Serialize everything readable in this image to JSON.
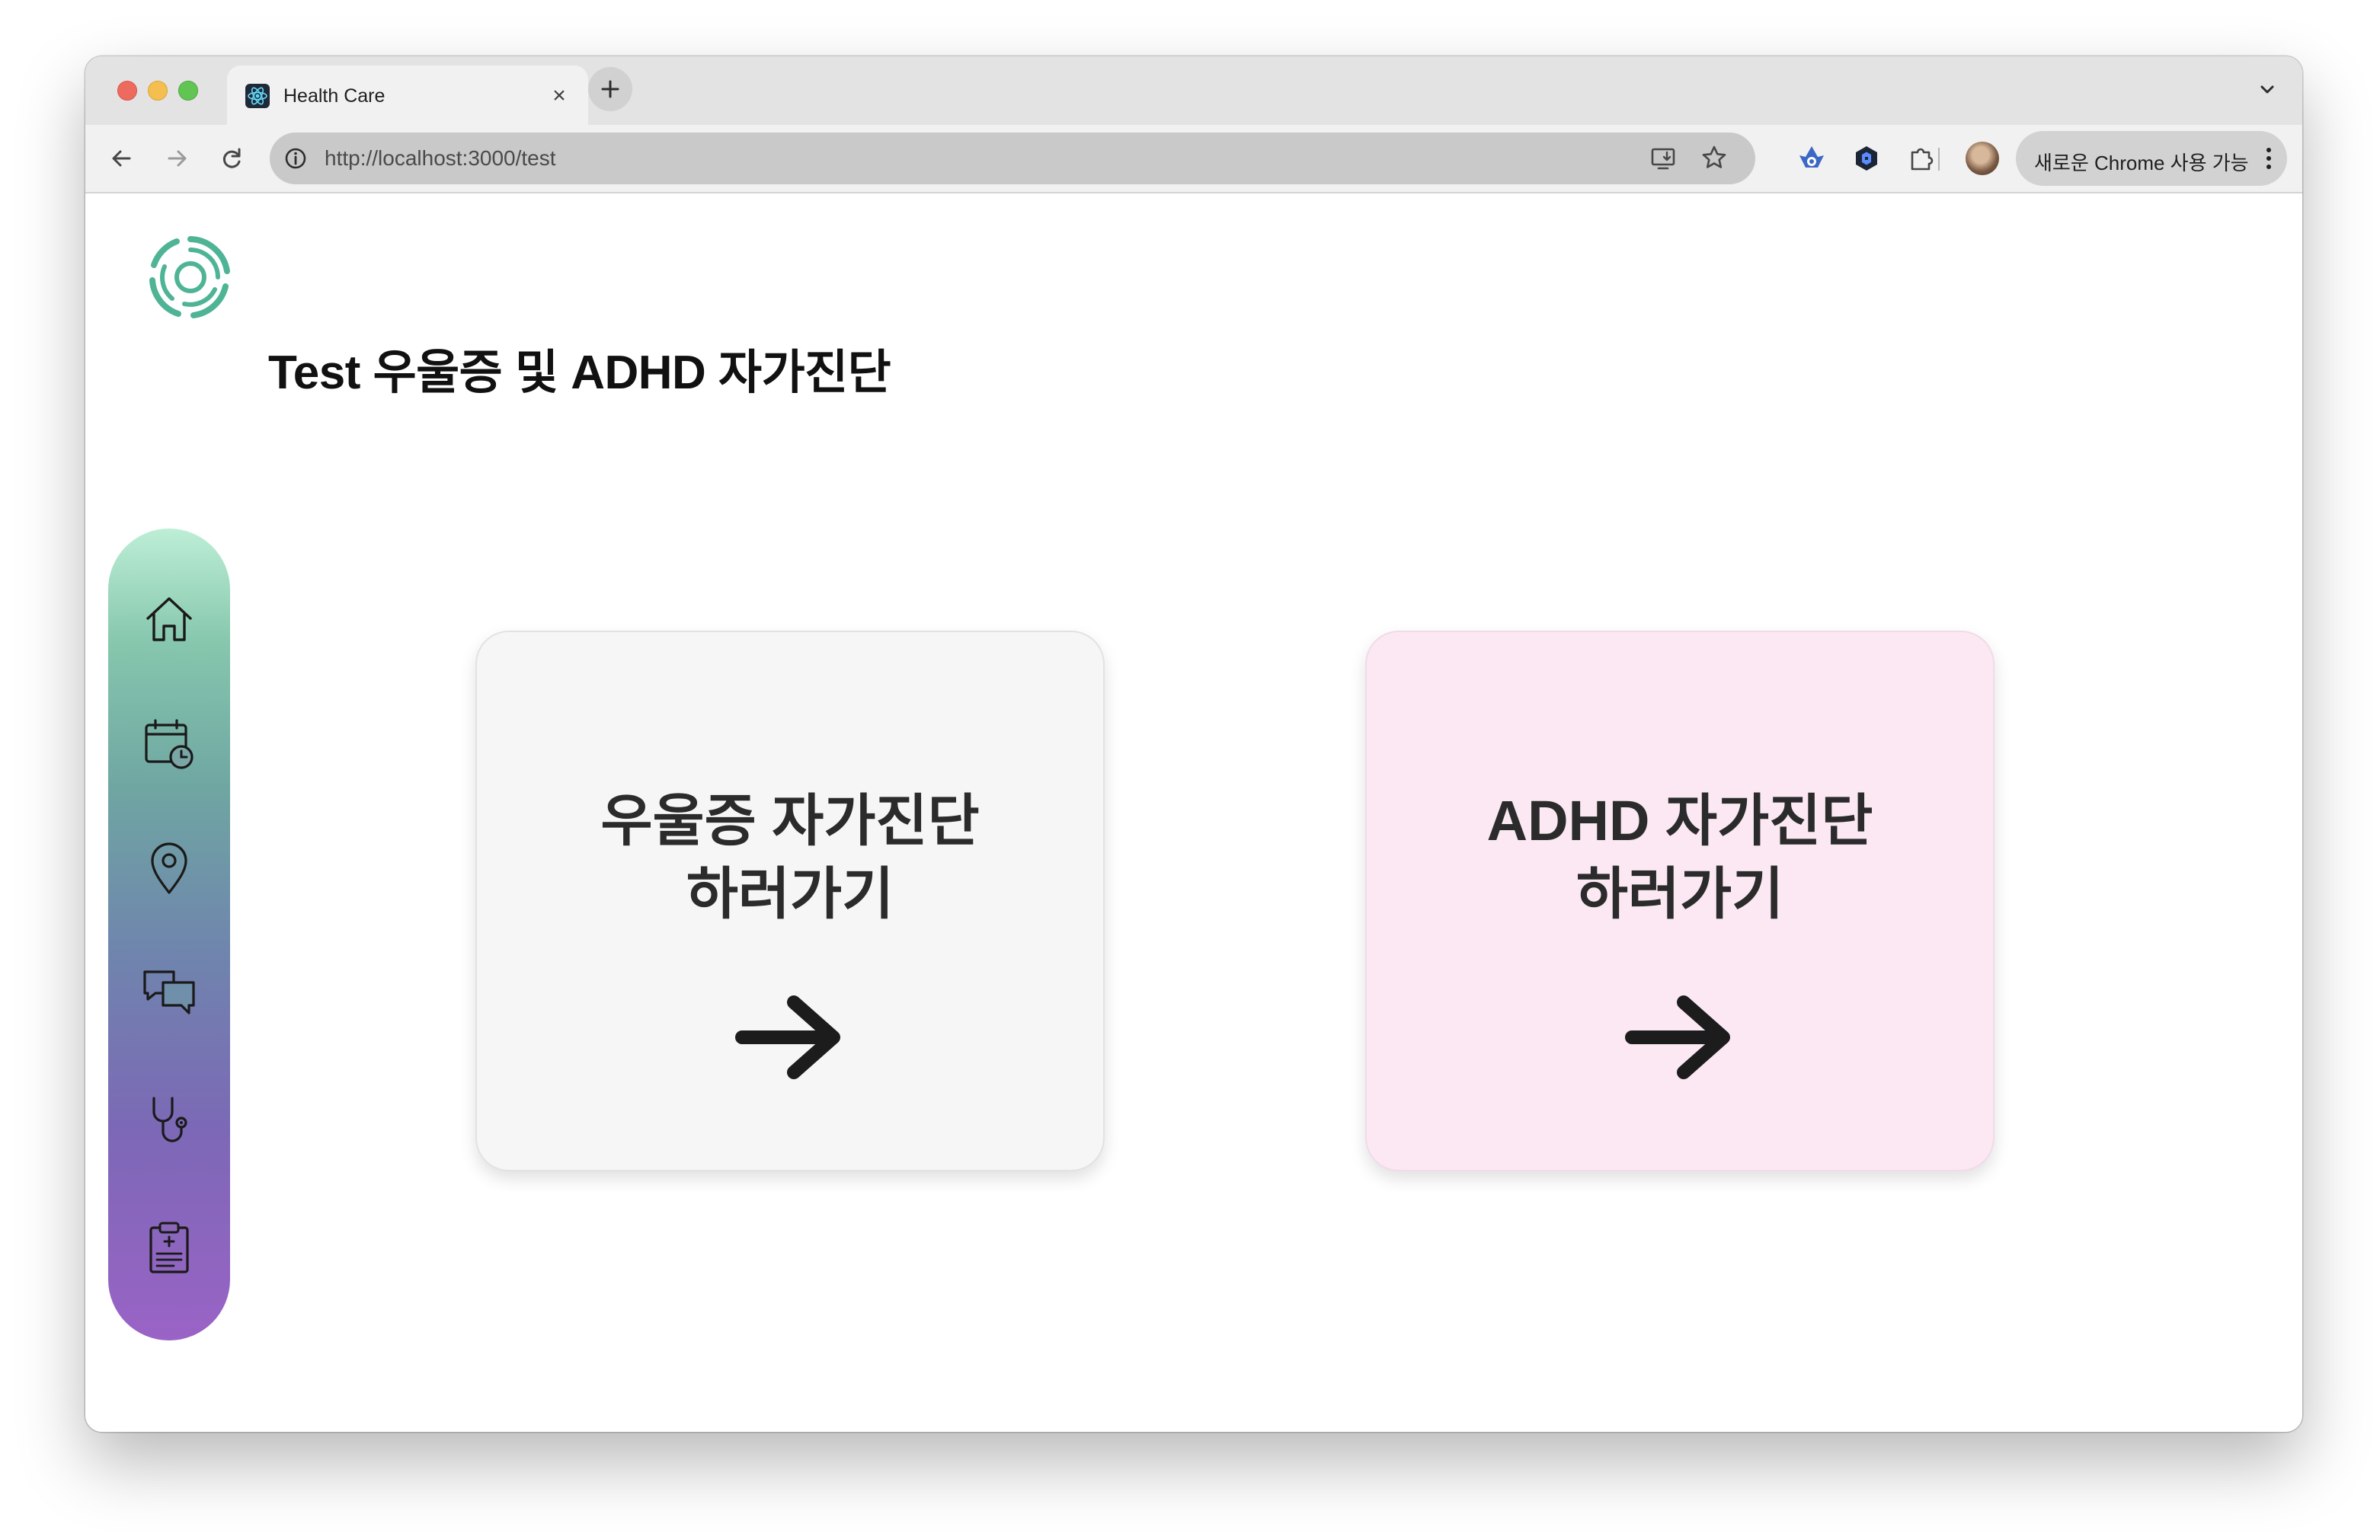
{
  "browser": {
    "tab_title": "Health Care",
    "tab_favicon": "react-atom-icon",
    "tab_close": "×",
    "url": "http://localhost:3000/test",
    "update_button_label": "새로운 Chrome 사용 가능",
    "toolbar_icons": [
      "back-arrow-icon",
      "forward-arrow-icon",
      "reload-icon",
      "site-info-icon",
      "install-app-icon",
      "bookmark-star-icon",
      "extension-icon-1",
      "extension-icon-2",
      "puzzle-extensions-icon",
      "profile-avatar",
      "kebab-menu-icon"
    ]
  },
  "page": {
    "title": "Test 우울증 및 ADHD 자가진단",
    "logo": "circular-leaf-logo-icon",
    "accent_color": "#4fb396"
  },
  "sidebar": {
    "gradient": [
      "#bdeed6",
      "#86c7ad",
      "#6f85ad",
      "#9a63c6"
    ],
    "items": [
      {
        "icon": "home-icon"
      },
      {
        "icon": "calendar-clock-icon"
      },
      {
        "icon": "location-pin-icon"
      },
      {
        "icon": "chat-bubbles-icon"
      },
      {
        "icon": "stethoscope-icon"
      },
      {
        "icon": "clipboard-medical-icon"
      }
    ]
  },
  "cards": [
    {
      "line1": "우울증 자가진단",
      "line2": "하러가기",
      "background": "#f6f6f6",
      "icon": "arrow-right-icon"
    },
    {
      "line1": "ADHD 자가진단",
      "line2": "하러가기",
      "background": "#fbe8f3",
      "icon": "arrow-right-icon"
    }
  ]
}
